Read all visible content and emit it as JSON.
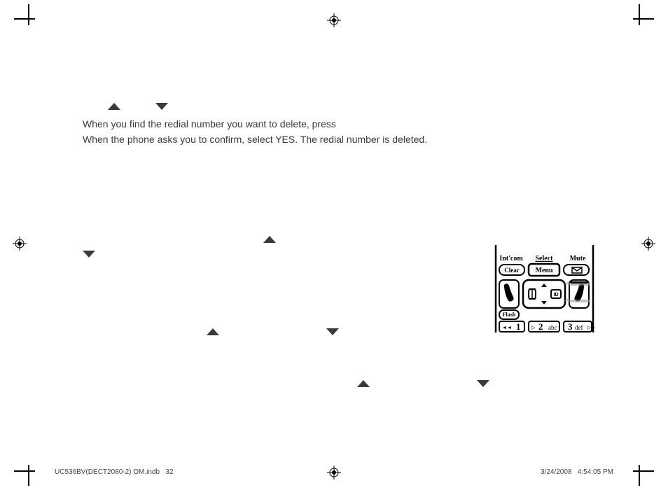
{
  "body": {
    "line1": "When you find the redial number you want to delete, press",
    "line2": "When the phone asks you to confirm, select YES. The redial number is deleted."
  },
  "phone": {
    "keys": {
      "intcom": "Int'com",
      "select": "Select",
      "mute": "Mute",
      "clear": "Clear",
      "menu": "Menu",
      "flash": "Flash",
      "one": "1",
      "two": "2",
      "two_abc": "abc",
      "three": "3",
      "three_def": "def"
    }
  },
  "footer": {
    "filename": "UC536BV(DECT2080-2) OM.indb",
    "page": "32",
    "date": "3/24/2008",
    "time": "4:54:05 PM"
  }
}
